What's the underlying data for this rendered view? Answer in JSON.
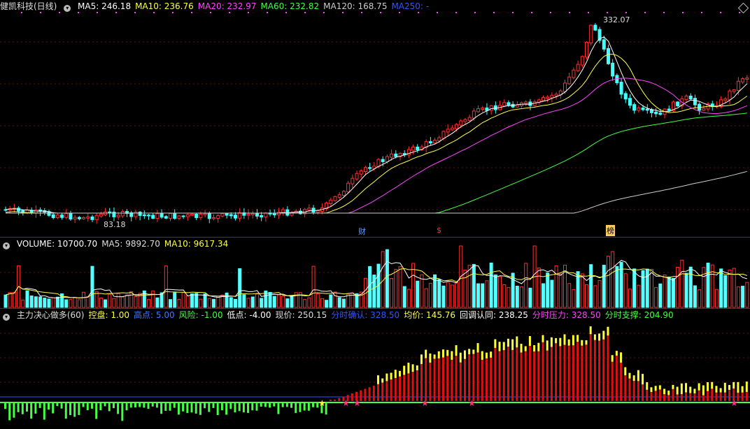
{
  "main": {
    "title": "健凯科技(日线)",
    "ma": [
      {
        "label": "MA5: 246.18",
        "color": "#ffffff"
      },
      {
        "label": "MA10: 236.76",
        "color": "#ffff44"
      },
      {
        "label": "MA20: 232.97",
        "color": "#ff44ff"
      },
      {
        "label": "MA60: 232.82",
        "color": "#44ff44"
      },
      {
        "label": "MA120: 168.75",
        "color": "#cccccc"
      },
      {
        "label": "MA250: -",
        "color": "#3355ff"
      }
    ],
    "high_label": "332.07",
    "low_label": "83.18",
    "markers": [
      {
        "text": "财",
        "color": "#6699ff"
      },
      {
        "text": "$",
        "color": "#ff3333"
      },
      {
        "text": "榜",
        "color": "#ffcc66"
      }
    ]
  },
  "volume": {
    "labels": [
      {
        "label": "VOLUME: 10700.70",
        "color": "#ffffff"
      },
      {
        "label": "MA5: 9892.70",
        "color": "#dddddd"
      },
      {
        "label": "MA10: 9617.34",
        "color": "#ffff44"
      }
    ]
  },
  "indicator": {
    "labels": [
      {
        "label": "主力决心做多(60)",
        "color": "#dddddd"
      },
      {
        "label": "控盘: 1.00",
        "color": "#ffff44"
      },
      {
        "label": "高点: 5.00",
        "color": "#4477ff"
      },
      {
        "label": "风险: -1.00",
        "color": "#44ff44"
      },
      {
        "label": "低点: -4.00",
        "color": "#ffffff"
      },
      {
        "label": "现价: 250.15",
        "color": "#dddddd"
      },
      {
        "label": "分时确认: 328.50",
        "color": "#3355ff"
      },
      {
        "label": "均价: 145.76",
        "color": "#ffff44"
      },
      {
        "label": "回调认同: 238.25",
        "color": "#ffffff"
      },
      {
        "label": "分时压力: 328.50",
        "color": "#ff44ff"
      },
      {
        "label": "分时支撑: 204.90",
        "color": "#44ff44"
      }
    ]
  },
  "chart_data": [
    {
      "type": "candlestick",
      "title": "健凯科技(日线)",
      "annotations": {
        "high": 332.07,
        "low": 83.18
      },
      "approx_close_path": [
        90,
        88,
        87,
        85,
        84,
        86,
        88,
        90,
        92,
        95,
        100,
        112,
        125,
        145,
        150,
        160,
        175,
        190,
        200,
        220,
        240,
        260,
        275,
        300,
        332,
        300,
        260,
        240,
        235,
        230,
        245,
        240,
        235,
        240,
        245,
        250
      ]
    },
    {
      "type": "bar",
      "title": "VOLUME",
      "values_latest": {
        "VOLUME": 10700.7,
        "MA5": 9892.7,
        "MA10": 9617.34
      }
    }
  ]
}
